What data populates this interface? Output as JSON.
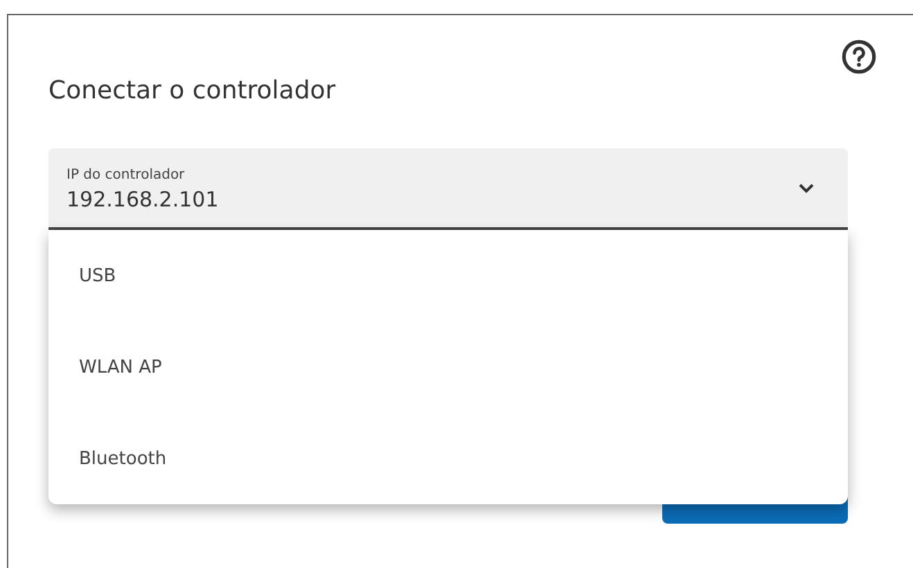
{
  "dialog": {
    "title": "Conectar o controlador"
  },
  "field": {
    "label": "IP do controlador",
    "value": "192.168.2.101"
  },
  "dropdown_options": [
    {
      "label": "USB"
    },
    {
      "label": "WLAN AP"
    },
    {
      "label": "Bluetooth"
    }
  ]
}
